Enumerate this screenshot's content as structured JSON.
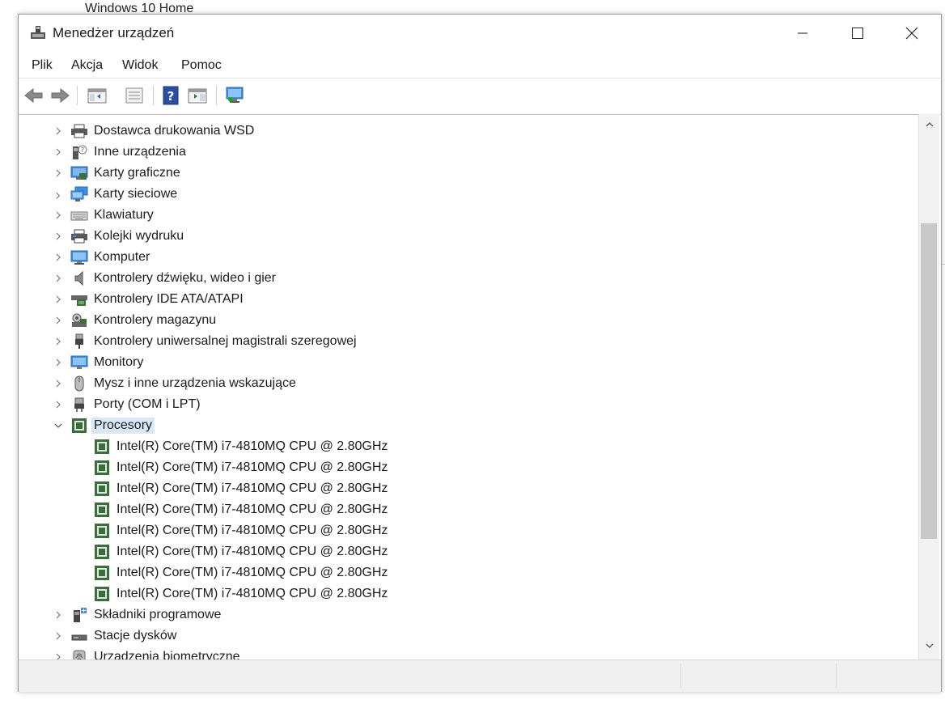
{
  "background_window_text": "Windows 10 Home",
  "window": {
    "title": "Menedżer urządzeń",
    "controls": {
      "minimize": "minimize",
      "maximize": "maximize",
      "close": "close"
    }
  },
  "menu": {
    "items": [
      "Plik",
      "Akcja",
      "Widok",
      "Pomoc"
    ]
  },
  "toolbar": {
    "buttons": [
      "back-arrow-icon",
      "forward-arrow-icon",
      "show-hide-console-tree-icon",
      "properties-icon",
      "help-icon",
      "action-pane-icon",
      "scan-hardware-icon"
    ]
  },
  "tree": {
    "categories": [
      {
        "label": "Dostawca drukowania WSD",
        "icon": "printer-icon",
        "expanded": false
      },
      {
        "label": "Inne urządzenia",
        "icon": "unknown-device-icon",
        "expanded": false
      },
      {
        "label": "Karty graficzne",
        "icon": "display-adapter-icon",
        "expanded": false
      },
      {
        "label": "Karty sieciowe",
        "icon": "network-adapter-icon",
        "expanded": false
      },
      {
        "label": "Klawiatury",
        "icon": "keyboard-icon",
        "expanded": false
      },
      {
        "label": "Kolejki wydruku",
        "icon": "print-queue-icon",
        "expanded": false
      },
      {
        "label": "Komputer",
        "icon": "computer-icon",
        "expanded": false
      },
      {
        "label": "Kontrolery dźwięku, wideo i gier",
        "icon": "speaker-icon",
        "expanded": false
      },
      {
        "label": "Kontrolery IDE ATA/ATAPI",
        "icon": "ide-controller-icon",
        "expanded": false
      },
      {
        "label": "Kontrolery magazynu",
        "icon": "storage-controller-icon",
        "expanded": false
      },
      {
        "label": "Kontrolery uniwersalnej magistrali szeregowej",
        "icon": "usb-icon",
        "expanded": false
      },
      {
        "label": "Monitory",
        "icon": "monitor-icon",
        "expanded": false
      },
      {
        "label": "Mysz i inne urządzenia wskazujące",
        "icon": "mouse-icon",
        "expanded": false
      },
      {
        "label": "Porty (COM i LPT)",
        "icon": "port-icon",
        "expanded": false
      },
      {
        "label": "Procesory",
        "icon": "processor-icon",
        "expanded": true,
        "selected": true
      }
    ],
    "processors": [
      "Intel(R) Core(TM) i7-4810MQ CPU @ 2.80GHz",
      "Intel(R) Core(TM) i7-4810MQ CPU @ 2.80GHz",
      "Intel(R) Core(TM) i7-4810MQ CPU @ 2.80GHz",
      "Intel(R) Core(TM) i7-4810MQ CPU @ 2.80GHz",
      "Intel(R) Core(TM) i7-4810MQ CPU @ 2.80GHz",
      "Intel(R) Core(TM) i7-4810MQ CPU @ 2.80GHz",
      "Intel(R) Core(TM) i7-4810MQ CPU @ 2.80GHz",
      "Intel(R) Core(TM) i7-4810MQ CPU @ 2.80GHz"
    ],
    "after_categories": [
      {
        "label": "Składniki programowe",
        "icon": "software-component-icon",
        "expanded": false
      },
      {
        "label": "Stacje dysków",
        "icon": "disk-drive-icon",
        "expanded": false
      },
      {
        "label": "Urządzenia biometryczne",
        "icon": "biometric-device-icon",
        "expanded": false
      }
    ]
  },
  "colors": {
    "selection": "#d9e7f7",
    "processor_chip": "#3a6e3a",
    "monitor_blue": "#3d8fe0"
  }
}
